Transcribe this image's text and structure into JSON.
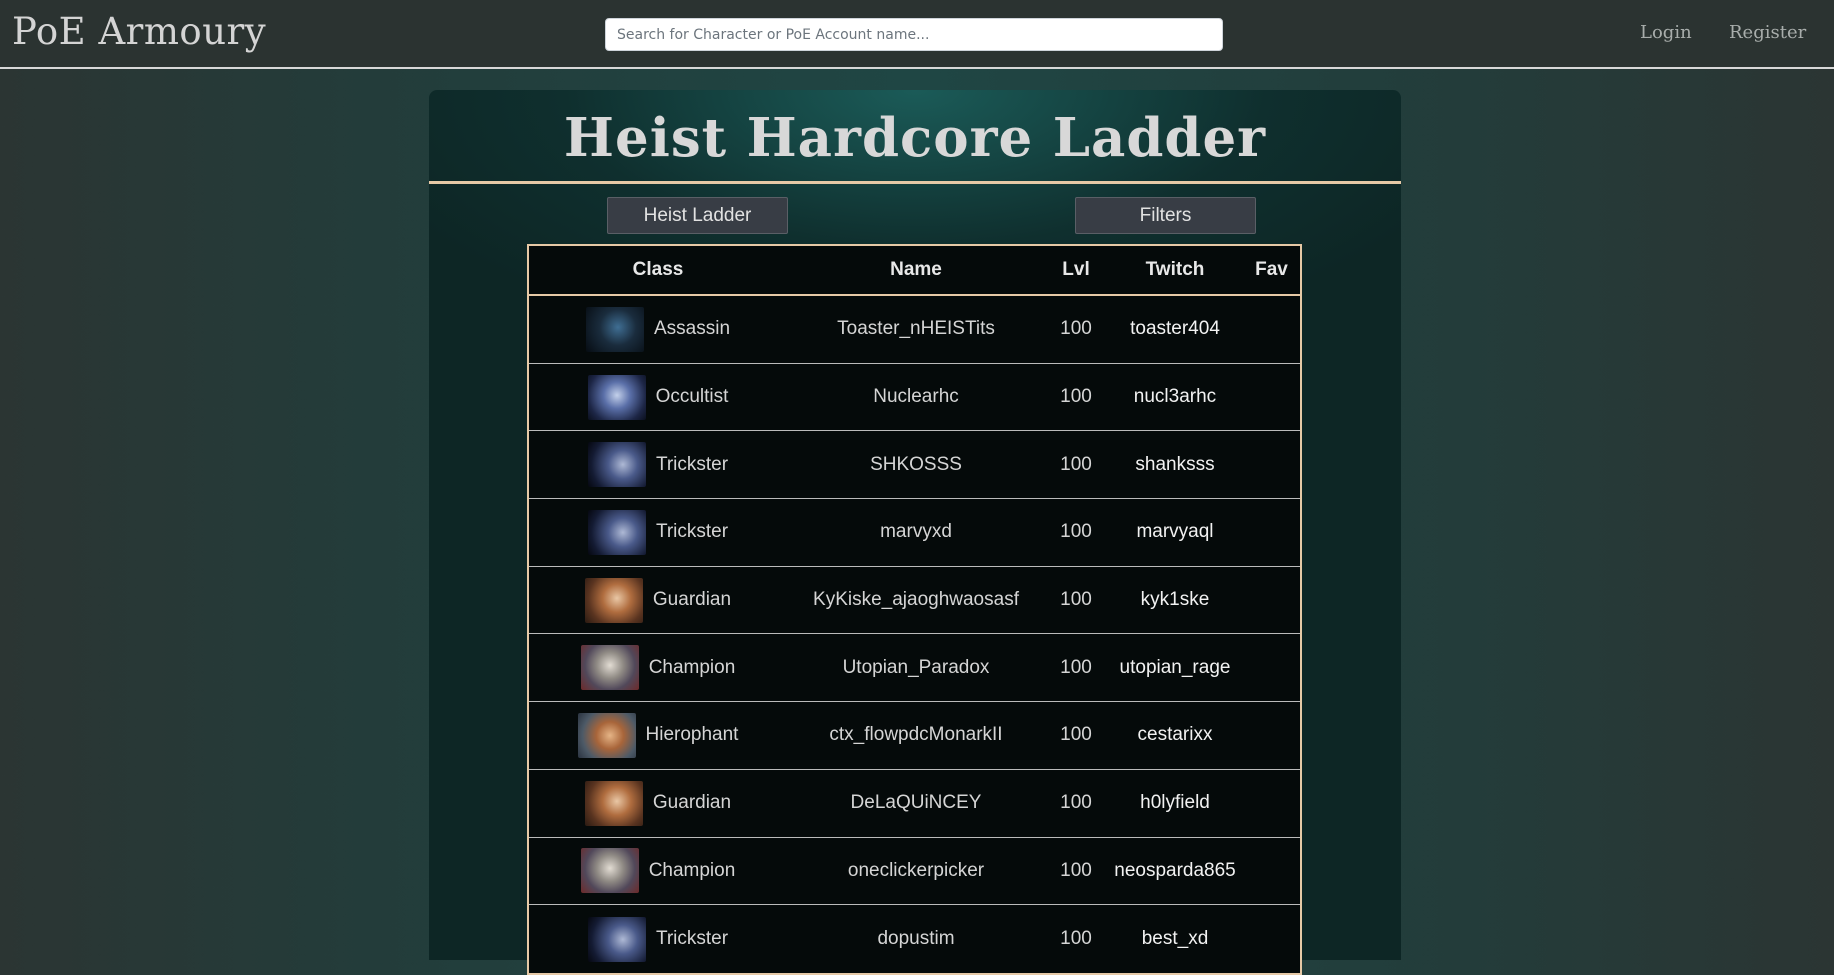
{
  "navbar": {
    "brand": "PoE Armoury",
    "search_placeholder": "Search for Character or PoE Account name...",
    "login": "Login",
    "register": "Register"
  },
  "page": {
    "title": "Heist Hardcore Ladder",
    "ladder_button": "Heist Ladder",
    "filters_button": "Filters"
  },
  "table": {
    "headers": {
      "class": "Class",
      "name": "Name",
      "lvl": "Lvl",
      "twitch": "Twitch",
      "fav": "Fav"
    },
    "rows": [
      {
        "class": "Assassin",
        "avatar": "assassin-portrait",
        "name": "Toaster_nHEISTits",
        "lvl": "100",
        "twitch": "toaster404"
      },
      {
        "class": "Occultist",
        "avatar": "occultist-portrait",
        "name": "Nuclearhc",
        "lvl": "100",
        "twitch": "nucl3arhc"
      },
      {
        "class": "Trickster",
        "avatar": "trickster-portrait",
        "name": "SHKOSSS",
        "lvl": "100",
        "twitch": "shanksss"
      },
      {
        "class": "Trickster",
        "avatar": "trickster-portrait",
        "name": "marvyxd",
        "lvl": "100",
        "twitch": "marvyaql"
      },
      {
        "class": "Guardian",
        "avatar": "guardian-portrait",
        "name": "KyKiske_ajaoghwaosasf",
        "lvl": "100",
        "twitch": "kyk1ske"
      },
      {
        "class": "Champion",
        "avatar": "champion-portrait",
        "name": "Utopian_Paradox",
        "lvl": "100",
        "twitch": "utopian_rage"
      },
      {
        "class": "Hierophant",
        "avatar": "hierophant-portrait",
        "name": "ctx_flowpdcMonarkII",
        "lvl": "100",
        "twitch": "cestarixx"
      },
      {
        "class": "Guardian",
        "avatar": "guardian-portrait",
        "name": "DeLaQUiNCEY",
        "lvl": "100",
        "twitch": "h0lyfield"
      },
      {
        "class": "Champion",
        "avatar": "champion-portrait",
        "name": "oneclickerpicker",
        "lvl": "100",
        "twitch": "neosparda865"
      },
      {
        "class": "Trickster",
        "avatar": "trickster-portrait",
        "name": "dopustim",
        "lvl": "100",
        "twitch": "best_xd"
      }
    ]
  }
}
